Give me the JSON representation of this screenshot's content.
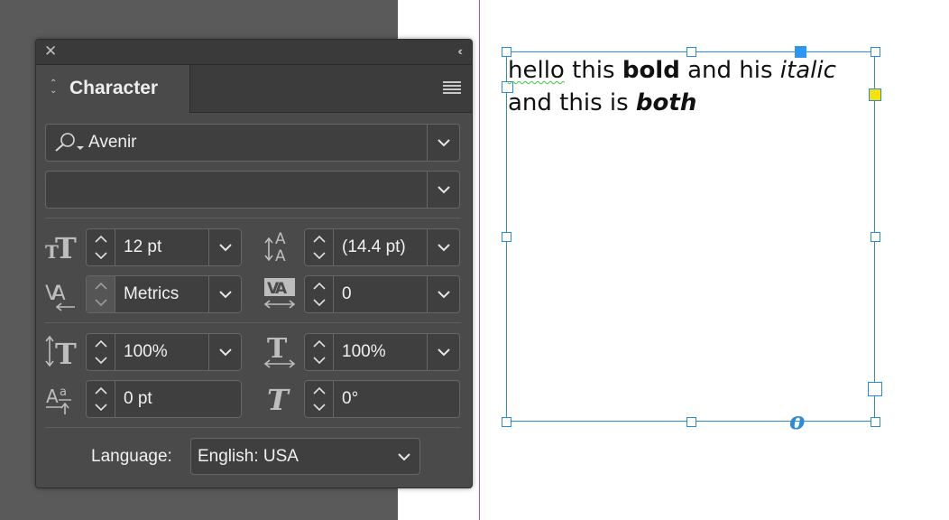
{
  "panel": {
    "close_glyph": "✕",
    "collapse_glyph": "‹‹",
    "tab_title": "Character",
    "font_family": "Avenir",
    "font_style": "",
    "size": "12 pt",
    "leading": "(14.4 pt)",
    "kerning": "Metrics",
    "tracking": "0",
    "vertical_scale": "100%",
    "horizontal_scale": "100%",
    "baseline_shift": "0 pt",
    "skew": "0°",
    "language_label": "Language:",
    "language_value": "English: USA"
  },
  "text_frame": {
    "line1": {
      "a": "hello",
      "b": " this ",
      "bold": "bold",
      "c": " and his ",
      "italic": "italic"
    },
    "line2": {
      "a": "and this is ",
      "both": "both"
    },
    "overset_glyph": "o"
  },
  "colors": {
    "accent": "#2a8bd8",
    "margin_guide": "#b04ec0",
    "panel_bg": "#4a4a4a",
    "pasteboard": "#5a5a5a"
  }
}
